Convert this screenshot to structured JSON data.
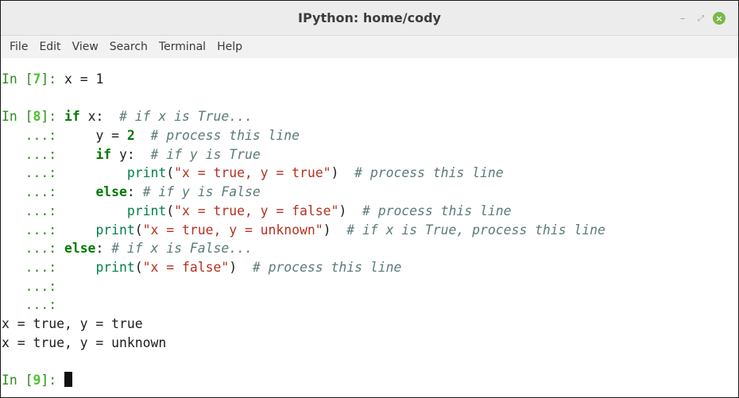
{
  "window": {
    "title": "IPython: home/cody",
    "minimize_glyph": "–",
    "maximize_glyph": "⤢",
    "close_glyph": "×"
  },
  "menubar": {
    "items": [
      "File",
      "Edit",
      "View",
      "Search",
      "Terminal",
      "Help"
    ]
  },
  "terminal": {
    "in7": {
      "prompt": "In [",
      "num": "7",
      "suffix": "]: ",
      "code": "x = 1"
    },
    "in8_prompt": {
      "prompt": "In [",
      "num": "8",
      "suffix": "]: "
    },
    "cont": "   ...: ",
    "cont_short": "   ...:",
    "code": {
      "l1_kw": "if",
      "l1_rest": " x:  ",
      "l1_cmt": "# if x is True...",
      "l2_indent": "    ",
      "l2_code": "y = ",
      "l2_num": "2",
      "l2_cmt": "  # process this line",
      "l3_kw": "if",
      "l3_rest": " y:  ",
      "l3_cmt": "# if y is True",
      "l4_indent": "        ",
      "l4_fn": "print",
      "l4_open": "(",
      "l4_str": "\"x = true, y = true\"",
      "l4_close": ")  ",
      "l4_cmt": "# process this line",
      "l5_kw": "else",
      "l5_rest": ": ",
      "l5_cmt": "# if y is False",
      "l6_fn": "print",
      "l6_str": "\"x = true, y = false\"",
      "l6_cmt": "# process this line",
      "l7_fn": "print",
      "l7_str": "\"x = true, y = unknown\"",
      "l7_cmt": "# if x is True, process this line",
      "l8_kw": "else",
      "l8_rest": ": ",
      "l8_cmt": "# if x is False...",
      "l9_fn": "print",
      "l9_str": "\"x = false\"",
      "l9_cmt": "# process this line"
    },
    "output": [
      "x = true, y = true",
      "x = true, y = unknown"
    ],
    "in9": {
      "prompt": "In [",
      "num": "9",
      "suffix": "]: "
    }
  }
}
